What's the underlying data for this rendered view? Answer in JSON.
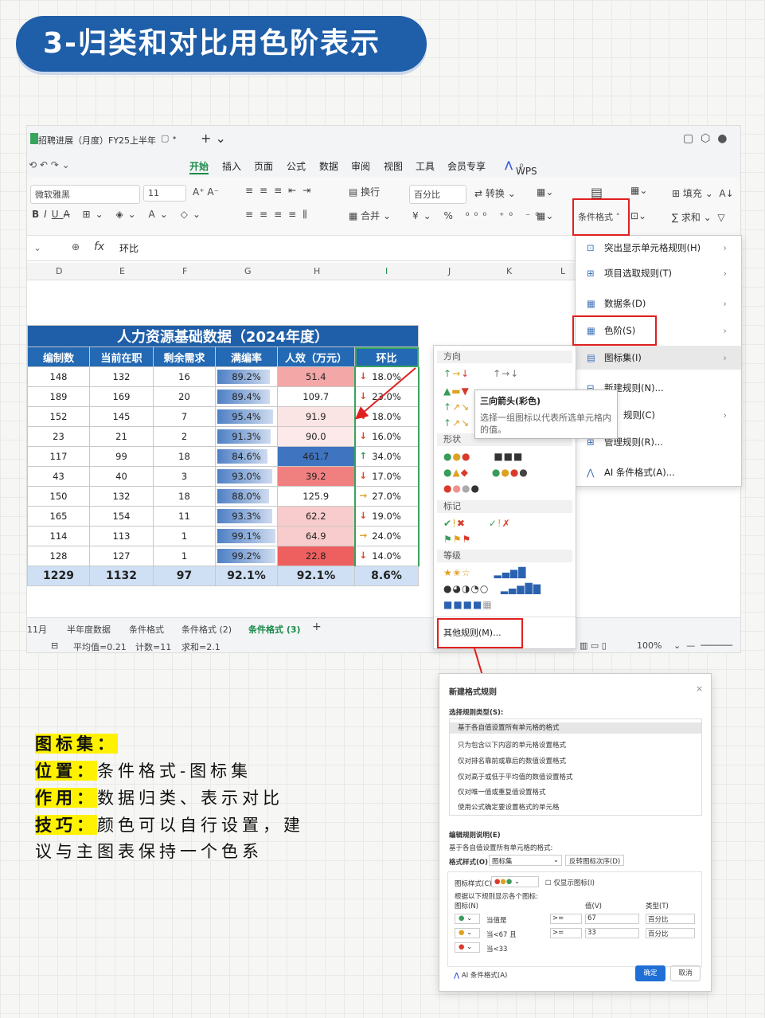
{
  "banner": {
    "title": "3-归类和对比用色阶表示"
  },
  "window": {
    "tab_title": "招聘进展（月度）FY25上半年"
  },
  "menu": [
    "开始",
    "插入",
    "页面",
    "公式",
    "数据",
    "审阅",
    "视图",
    "工具",
    "会员专享",
    "WPS AI"
  ],
  "ribbon": {
    "font": "微软雅黑",
    "size": "11",
    "wrap": "换行",
    "merge": "合并",
    "number_format": "百分比",
    "convert": "转换",
    "cond_format": "条件格式",
    "fill": "填充",
    "sum": "求和"
  },
  "formula": {
    "fx": "fx",
    "value": "环比"
  },
  "columns": [
    "D",
    "E",
    "F",
    "G",
    "H",
    "I",
    "J",
    "K",
    "L"
  ],
  "table": {
    "title": "人力资源基础数据（2024年度）",
    "headers": [
      "编制数",
      "当前在职",
      "剩余需求",
      "满编率",
      "人效（万元）",
      "环比"
    ],
    "rows": [
      [
        "148",
        "132",
        "16",
        "89.2%",
        "51.4",
        "18.0%"
      ],
      [
        "189",
        "169",
        "20",
        "89.4%",
        "109.7",
        "23.0%"
      ],
      [
        "152",
        "145",
        "7",
        "95.4%",
        "91.9",
        "18.0%"
      ],
      [
        "23",
        "21",
        "2",
        "91.3%",
        "90.0",
        "16.0%"
      ],
      [
        "117",
        "99",
        "18",
        "84.6%",
        "461.7",
        "34.0%"
      ],
      [
        "43",
        "40",
        "3",
        "93.0%",
        "39.2",
        "17.0%"
      ],
      [
        "150",
        "132",
        "18",
        "88.0%",
        "125.9",
        "27.0%"
      ],
      [
        "165",
        "154",
        "11",
        "93.3%",
        "62.2",
        "19.0%"
      ],
      [
        "114",
        "113",
        "1",
        "99.1%",
        "64.9",
        "24.0%"
      ],
      [
        "128",
        "127",
        "1",
        "99.2%",
        "22.8",
        "14.0%"
      ]
    ],
    "total": [
      "1229",
      "1132",
      "97",
      "92.1%",
      "92.1%",
      "8.6%"
    ],
    "arrow_types": [
      "down",
      "down",
      "down",
      "down",
      "up",
      "down",
      "right",
      "down",
      "right",
      "down"
    ],
    "fill_levels": [
      0.89,
      0.89,
      0.95,
      0.91,
      0.85,
      0.93,
      0.88,
      0.93,
      0.99,
      0.99
    ],
    "heat_colors": [
      "#f4a7a7",
      "#ffffff",
      "#fbe4e4",
      "#fde9e9",
      "#3f74c0",
      "#f07f7f",
      "#ffffff",
      "#f8cccc",
      "#f8cccc",
      "#ee5f5f"
    ]
  },
  "sheets": [
    "11月",
    "半年度数据",
    "条件格式",
    "条件格式 (2)",
    "条件格式 (3)",
    "+"
  ],
  "status": {
    "avg": "平均值=0.21",
    "count": "计数=11",
    "sum": "求和=2.1",
    "zoom": "100%"
  },
  "dropdown": [
    "突出显示单元格规则(H)",
    "项目选取规则(T)",
    "数据条(D)",
    "色阶(S)",
    "图标集(I)",
    "新建规则(N)...",
    "规则(C)",
    "管理规则(R)...",
    "AI 条件格式(A)..."
  ],
  "iconpanel": {
    "sections": [
      "方向",
      "形状",
      "标记",
      "等级"
    ],
    "more": "其他规则(M)..."
  },
  "tooltip": {
    "title": "三向箭头(彩色)",
    "desc": "选择一组图标以代表所选单元格内的值。"
  },
  "dialog": {
    "title": "新建格式规则",
    "type_label": "选择规则类型(S):",
    "types": [
      "基于各自值设置所有单元格的格式",
      "只为包含以下内容的单元格设置格式",
      "仅对排名靠前或靠后的数值设置格式",
      "仅对高于或低于平均值的数值设置格式",
      "仅对唯一值或重复值设置格式",
      "使用公式确定要设置格式的单元格"
    ],
    "edit_label": "编辑规则说明(E)",
    "edit_desc": "基于各自值设置所有单元格的格式:",
    "style_label": "格式样式(O)",
    "style_value": "图标集",
    "reverse": "反转图标次序(D)",
    "iconstyle_label": "图标样式(C)",
    "show_icon_only": "仅显示图标(I)",
    "rule_desc": "根据以下规则显示各个图标:",
    "col_icon": "图标(N)",
    "col_value": "值(V)",
    "col_type": "类型(T)",
    "rules": [
      {
        "cond": "当值是",
        "op": ">=",
        "val": "67",
        "type": "百分比"
      },
      {
        "cond": "当<67 且",
        "op": ">=",
        "val": "33",
        "type": "百分比"
      },
      {
        "cond": "当<33",
        "op": "",
        "val": "",
        "type": ""
      }
    ],
    "ai": "AI 条件格式(A)",
    "ok": "确定",
    "cancel": "取消"
  },
  "notes": {
    "l1_key": "图标集：",
    "l2_key": "位置：",
    "l2_val": "条件格式-图标集",
    "l3_key": "作用：",
    "l3_val": "数据归类、表示对比",
    "l4_key": "技巧：",
    "l4_val": "颜色可以自行设置，建",
    "l5": "议与主图表保持一个色系"
  }
}
